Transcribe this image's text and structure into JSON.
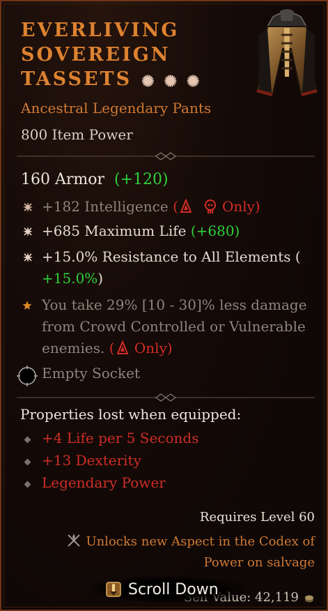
{
  "item": {
    "title_lines": [
      "Everliving",
      "Sovereign",
      "Tassets"
    ],
    "subtitle": "Ancestral Legendary Pants",
    "item_power": "800 Item Power",
    "rarity_stars_icon": "six-point-star-icon",
    "accent_color": "#dd8230"
  },
  "armor": {
    "label": "160 Armor",
    "bonus": "(+120)"
  },
  "affixes": [
    {
      "prefix": "+182 Intelligence",
      "restriction_open": "(",
      "restriction_close": " Only)",
      "dim": true
    },
    {
      "prefix": "+685 Maximum Life ",
      "bonus": "(+680)"
    },
    {
      "line1": "+15.0% Resistance to All Elements (",
      "line2": "+15.0%",
      "line2_close": ")"
    }
  ],
  "legendary": {
    "line1": "You take 29% [10 - 30]% less damage",
    "line2": "from Crowd Controlled or Vulnerable",
    "line3": "enemies.",
    "restriction_open": " (",
    "restriction_close": " Only)"
  },
  "socket": {
    "label": "Empty Socket"
  },
  "lost": {
    "heading": "Properties lost when equipped:",
    "items": [
      "+4 Life per 5 Seconds",
      "+13 Dexterity",
      "Legendary Power"
    ]
  },
  "requirements": {
    "level": "Requires Level 60",
    "unlock_line1": "Unlocks new Aspect in the Codex of",
    "unlock_line2": "Power on salvage"
  },
  "sell": {
    "label": "Sell Value: 42,119"
  },
  "prompt": {
    "label": "Scroll Down"
  }
}
